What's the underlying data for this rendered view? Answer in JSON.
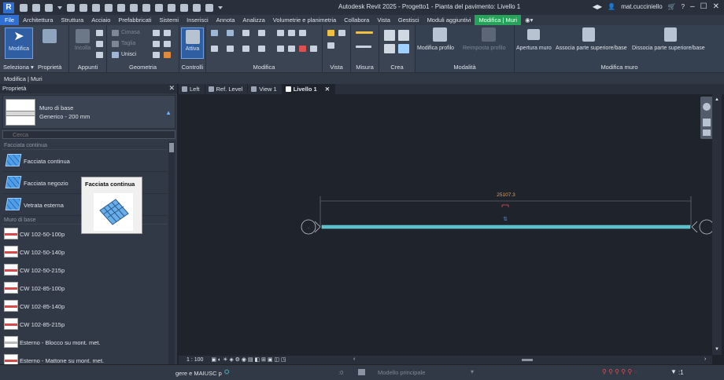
{
  "app": {
    "title": "Autodesk Revit 2025 - Progetto1 - Pianta del pavimento: Livello 1",
    "user": "mat.cucciniello",
    "logo": "R"
  },
  "menu_tabs": [
    "File",
    "Architettura",
    "Struttura",
    "Acciaio",
    "Prefabbricati",
    "Sistemi",
    "Inserisci",
    "Annota",
    "Analizza",
    "Volumetrie e planimetria",
    "Collabora",
    "Vista",
    "Gestisci",
    "Moduli aggiuntivi",
    "Modifica | Muri"
  ],
  "ribbon": {
    "modifica_label": "Modifica",
    "seleziona_label": "Seleziona ▾",
    "proprieta_label": "Proprietà",
    "incolla_label": "Incolla",
    "appunti_label": "Appunti",
    "geometria_label": "Geometria",
    "cima_label": "Cimasa",
    "taglia_label": "Taglia",
    "unisci_label": "Unisci",
    "attiva_label": "Attiva",
    "controlli_label": "Controlli",
    "modifica_panel_label": "Modifica",
    "vista_label": "Vista",
    "misura_label": "Misura",
    "crea_label": "Crea",
    "modifica_profilo": "Modifica profilo",
    "reimposta_profilo": "Reimposta profilo",
    "modalita_label": "Modalità",
    "apertura_muro": "Apertura muro",
    "associa": "Associa parte superiore/base",
    "dissocia": "Dissocia parte superiore/base",
    "modifica_muro_label": "Modifica muro"
  },
  "options_bar": "Modifica | Muri",
  "properties": {
    "header": "Proprietà",
    "type_name": "Muro di base",
    "type_sub": "Generico - 200 mm",
    "search_placeholder": "Cerca",
    "cat1": "Facciata continua",
    "cat1_items": [
      "Facciata continua",
      "Facciata negozio",
      "Vetrata esterna"
    ],
    "cat2": "Muro di base",
    "cat2_items": [
      "CW 102-50-100p",
      "CW 102-50-140p",
      "CW 102-50-215p",
      "CW 102-85-100p",
      "CW 102-85-140p",
      "CW 102-85-215p",
      "Esterno - Blocco su mont. met.",
      "Esterno - Mattone su mont. met."
    ],
    "tooltip_title": "Facciata continua"
  },
  "view_tabs": [
    "Left",
    "Ref. Level",
    "View 1",
    "Livello 1"
  ],
  "canvas": {
    "dimension": "25107.3",
    "wall_color": "#4fc0cc"
  },
  "view_control": {
    "scale": "1 : 100"
  },
  "status": {
    "hint": "gere e MAIUSC p",
    "workset_count": ":0",
    "model": "Modello principale",
    "filter_count": ":1"
  }
}
